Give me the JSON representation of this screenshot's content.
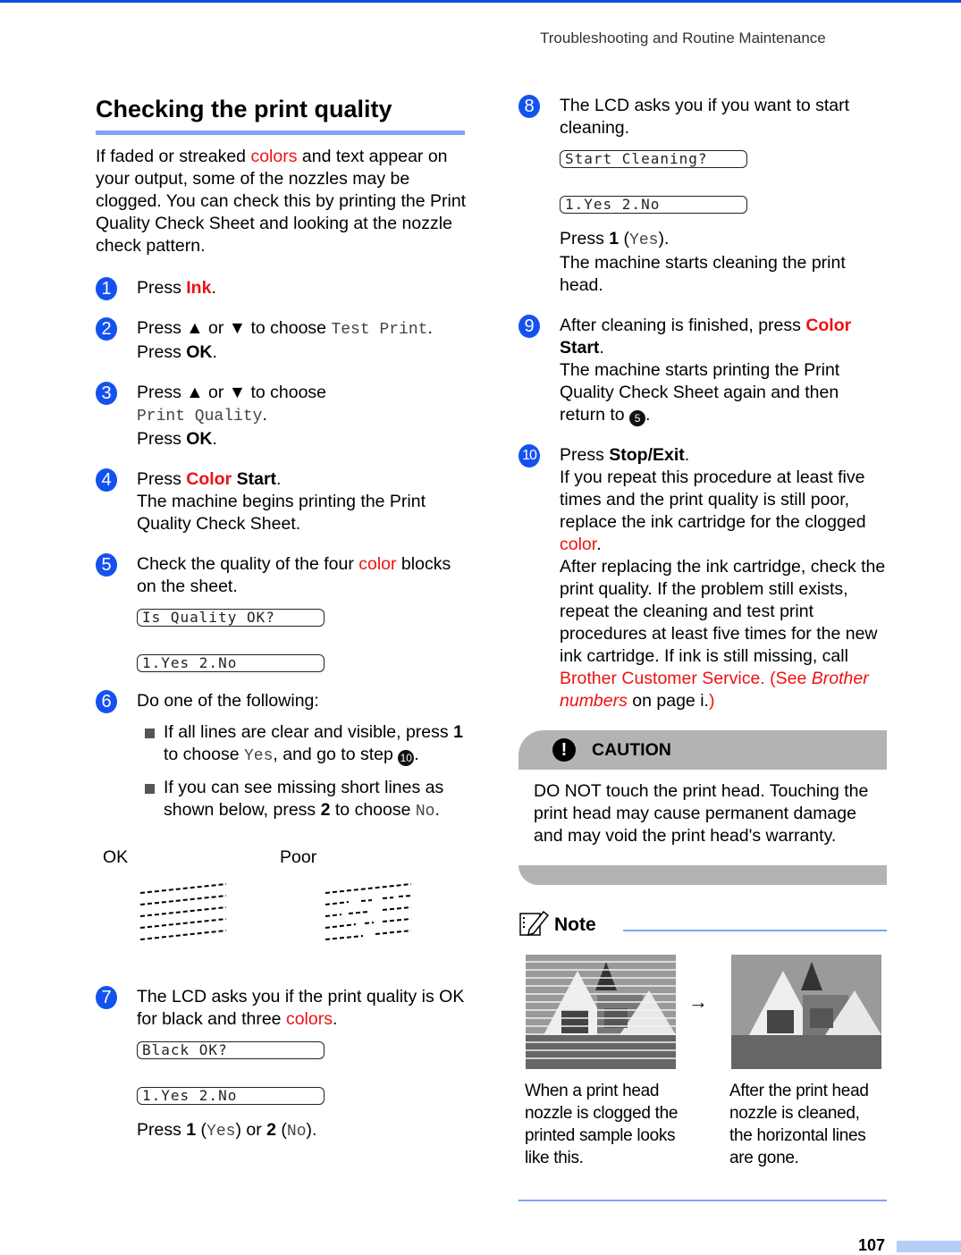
{
  "header": {
    "running_title": "Troubleshooting and Routine Maintenance"
  },
  "section": {
    "title": "Checking the print quality",
    "intro": {
      "pre": "If faded or streaked ",
      "link": "colors",
      "post": " and text appear on your output, some of the nozzles may be clogged. You can check this by printing the Print Quality Check Sheet and looking at the nozzle check pattern."
    }
  },
  "steps": [
    {
      "num": "1",
      "a": "Press ",
      "red_bold": "Ink",
      "b": "."
    },
    {
      "num": "2",
      "a": "Press ▲ or ▼ to choose ",
      "mono": "Test Print",
      "b": ".",
      "line2a": "Press ",
      "line2b": "OK",
      "line2c": "."
    },
    {
      "num": "3",
      "a": "Press ▲ or ▼ to choose",
      "mono": "Print Quality",
      "b": ".",
      "line2a": "Press ",
      "line2b": "OK",
      "line2c": "."
    },
    {
      "num": "4",
      "a": "Press ",
      "red_bold": "Color",
      "bold": " Start",
      "b": ".",
      "desc": "The machine begins printing the Print Quality Check Sheet."
    },
    {
      "num": "5",
      "a": "Check the quality of the four ",
      "red": "color",
      "b": " blocks on the sheet.",
      "lcd": [
        "Is Quality OK?",
        "1.Yes 2.No"
      ]
    },
    {
      "num": "6",
      "a": "Do one of the following:",
      "bullets": [
        {
          "a": "If all lines are clear and visible, press ",
          "bold": "1",
          "b": " to choose ",
          "mono": "Yes",
          "c": ", and go to step ",
          "ref": "10",
          "d": "."
        },
        {
          "a": "If you can see missing short lines as shown below, press ",
          "bold": "2",
          "b": " to choose ",
          "mono": "No",
          "c": "."
        }
      ]
    },
    {
      "num": "7",
      "a": "The LCD asks you if the print quality is OK for black and three ",
      "red": "colors",
      "b": ".",
      "lcd": [
        "Black OK?",
        "1.Yes 2.No"
      ],
      "after": {
        "a": "Press ",
        "b1": "1",
        "m1": "Yes",
        "mid": ") or ",
        "b2": "2",
        "m2": "No",
        "end": ")."
      }
    },
    {
      "num": "8",
      "a": "The LCD asks you if you want to start cleaning.",
      "lcd": [
        "Start Cleaning?",
        "1.Yes 2.No"
      ],
      "after": {
        "a": "Press ",
        "b1": "1",
        "m1": "Yes",
        "end": ").",
        "desc": "The machine starts cleaning the print head."
      }
    },
    {
      "num": "9",
      "a": "After cleaning is finished, press ",
      "red_bold": "Color",
      "bold": "Start",
      "b": ".",
      "desc_a": "The machine starts printing the Print Quality Check Sheet again and then return to ",
      "ref": "5",
      "desc_b": "."
    },
    {
      "num": "10",
      "a": "Press ",
      "bold": "Stop/Exit",
      "b": ".",
      "desc1": "If you repeat this procedure at least five times and the print quality is still poor, replace the ink cartridge for the clogged ",
      "desc1_red": "color",
      "desc2": "After replacing the ink cartridge, check the print quality. If the problem still exists, repeat the cleaning and test print procedures at least five times for the new ink cartridge. If ink is still missing, call ",
      "link1": "Brother Customer Service. (See ",
      "link_italic": "Brother numbers",
      "mid": " on page i.",
      "link_close": ")"
    }
  ],
  "pattern": {
    "ok_label": "OK",
    "poor_label": "Poor"
  },
  "caution": {
    "label": "CAUTION",
    "text": "DO NOT touch the print head. Touching the print head may cause permanent damage and may void the print head's warranty."
  },
  "note": {
    "label": "Note",
    "arrow": "→",
    "before_caption": "When a print head nozzle is clogged the printed sample looks like this.",
    "after_caption": "After the print head nozzle is cleaned, the horizontal lines are gone."
  },
  "footer": {
    "page_number": "107"
  }
}
